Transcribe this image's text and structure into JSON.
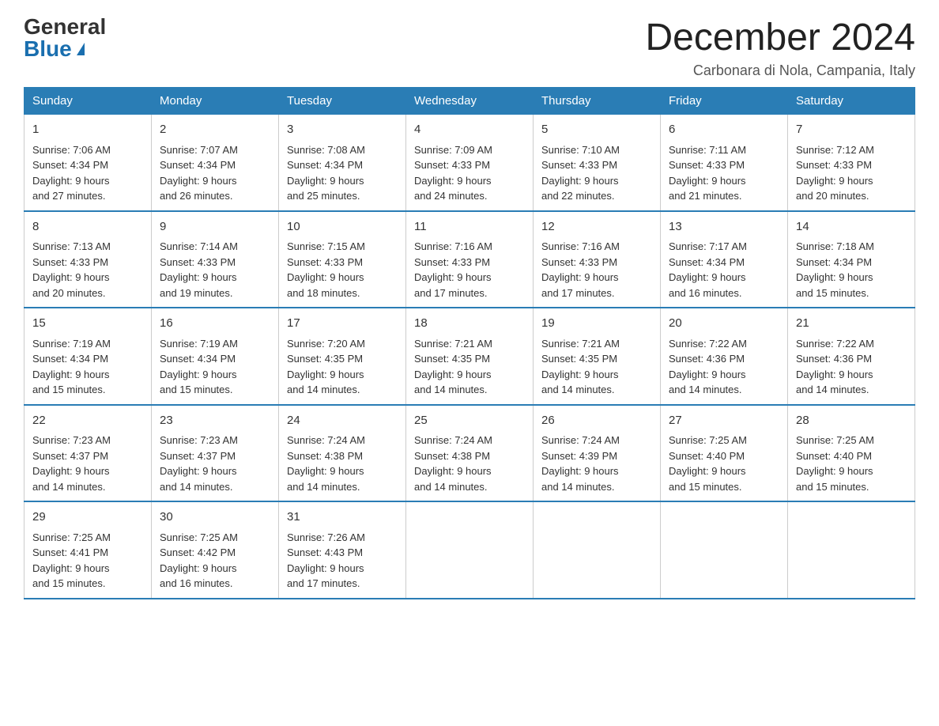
{
  "header": {
    "logo_general": "General",
    "logo_blue": "Blue",
    "month_title": "December 2024",
    "location": "Carbonara di Nola, Campania, Italy"
  },
  "days_of_week": [
    "Sunday",
    "Monday",
    "Tuesday",
    "Wednesday",
    "Thursday",
    "Friday",
    "Saturday"
  ],
  "weeks": [
    [
      {
        "day": "1",
        "sunrise": "7:06 AM",
        "sunset": "4:34 PM",
        "daylight": "9 hours and 27 minutes."
      },
      {
        "day": "2",
        "sunrise": "7:07 AM",
        "sunset": "4:34 PM",
        "daylight": "9 hours and 26 minutes."
      },
      {
        "day": "3",
        "sunrise": "7:08 AM",
        "sunset": "4:34 PM",
        "daylight": "9 hours and 25 minutes."
      },
      {
        "day": "4",
        "sunrise": "7:09 AM",
        "sunset": "4:33 PM",
        "daylight": "9 hours and 24 minutes."
      },
      {
        "day": "5",
        "sunrise": "7:10 AM",
        "sunset": "4:33 PM",
        "daylight": "9 hours and 22 minutes."
      },
      {
        "day": "6",
        "sunrise": "7:11 AM",
        "sunset": "4:33 PM",
        "daylight": "9 hours and 21 minutes."
      },
      {
        "day": "7",
        "sunrise": "7:12 AM",
        "sunset": "4:33 PM",
        "daylight": "9 hours and 20 minutes."
      }
    ],
    [
      {
        "day": "8",
        "sunrise": "7:13 AM",
        "sunset": "4:33 PM",
        "daylight": "9 hours and 20 minutes."
      },
      {
        "day": "9",
        "sunrise": "7:14 AM",
        "sunset": "4:33 PM",
        "daylight": "9 hours and 19 minutes."
      },
      {
        "day": "10",
        "sunrise": "7:15 AM",
        "sunset": "4:33 PM",
        "daylight": "9 hours and 18 minutes."
      },
      {
        "day": "11",
        "sunrise": "7:16 AM",
        "sunset": "4:33 PM",
        "daylight": "9 hours and 17 minutes."
      },
      {
        "day": "12",
        "sunrise": "7:16 AM",
        "sunset": "4:33 PM",
        "daylight": "9 hours and 17 minutes."
      },
      {
        "day": "13",
        "sunrise": "7:17 AM",
        "sunset": "4:34 PM",
        "daylight": "9 hours and 16 minutes."
      },
      {
        "day": "14",
        "sunrise": "7:18 AM",
        "sunset": "4:34 PM",
        "daylight": "9 hours and 15 minutes."
      }
    ],
    [
      {
        "day": "15",
        "sunrise": "7:19 AM",
        "sunset": "4:34 PM",
        "daylight": "9 hours and 15 minutes."
      },
      {
        "day": "16",
        "sunrise": "7:19 AM",
        "sunset": "4:34 PM",
        "daylight": "9 hours and 15 minutes."
      },
      {
        "day": "17",
        "sunrise": "7:20 AM",
        "sunset": "4:35 PM",
        "daylight": "9 hours and 14 minutes."
      },
      {
        "day": "18",
        "sunrise": "7:21 AM",
        "sunset": "4:35 PM",
        "daylight": "9 hours and 14 minutes."
      },
      {
        "day": "19",
        "sunrise": "7:21 AM",
        "sunset": "4:35 PM",
        "daylight": "9 hours and 14 minutes."
      },
      {
        "day": "20",
        "sunrise": "7:22 AM",
        "sunset": "4:36 PM",
        "daylight": "9 hours and 14 minutes."
      },
      {
        "day": "21",
        "sunrise": "7:22 AM",
        "sunset": "4:36 PM",
        "daylight": "9 hours and 14 minutes."
      }
    ],
    [
      {
        "day": "22",
        "sunrise": "7:23 AM",
        "sunset": "4:37 PM",
        "daylight": "9 hours and 14 minutes."
      },
      {
        "day": "23",
        "sunrise": "7:23 AM",
        "sunset": "4:37 PM",
        "daylight": "9 hours and 14 minutes."
      },
      {
        "day": "24",
        "sunrise": "7:24 AM",
        "sunset": "4:38 PM",
        "daylight": "9 hours and 14 minutes."
      },
      {
        "day": "25",
        "sunrise": "7:24 AM",
        "sunset": "4:38 PM",
        "daylight": "9 hours and 14 minutes."
      },
      {
        "day": "26",
        "sunrise": "7:24 AM",
        "sunset": "4:39 PM",
        "daylight": "9 hours and 14 minutes."
      },
      {
        "day": "27",
        "sunrise": "7:25 AM",
        "sunset": "4:40 PM",
        "daylight": "9 hours and 15 minutes."
      },
      {
        "day": "28",
        "sunrise": "7:25 AM",
        "sunset": "4:40 PM",
        "daylight": "9 hours and 15 minutes."
      }
    ],
    [
      {
        "day": "29",
        "sunrise": "7:25 AM",
        "sunset": "4:41 PM",
        "daylight": "9 hours and 15 minutes."
      },
      {
        "day": "30",
        "sunrise": "7:25 AM",
        "sunset": "4:42 PM",
        "daylight": "9 hours and 16 minutes."
      },
      {
        "day": "31",
        "sunrise": "7:26 AM",
        "sunset": "4:43 PM",
        "daylight": "9 hours and 17 minutes."
      },
      null,
      null,
      null,
      null
    ]
  ],
  "labels": {
    "sunrise": "Sunrise:",
    "sunset": "Sunset:",
    "daylight": "Daylight:"
  }
}
